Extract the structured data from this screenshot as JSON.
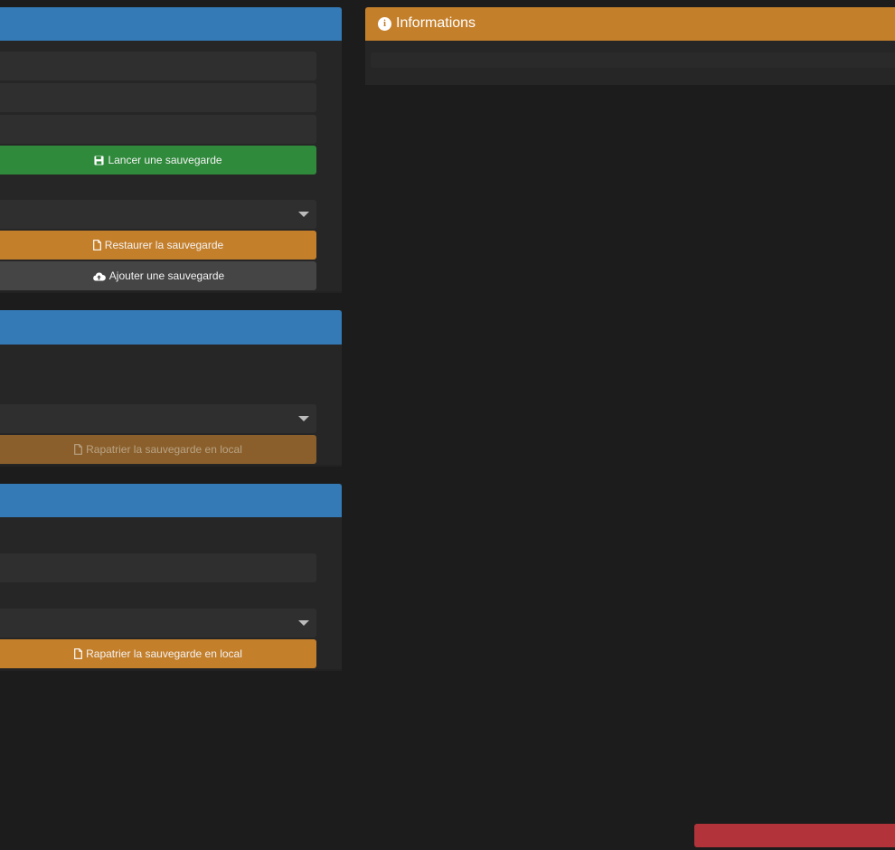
{
  "backup_panel": {
    "launch_button": "Lancer une sauvegarde",
    "restore_button": "Restaurer la sauvegarde",
    "add_button": "Ajouter une sauvegarde"
  },
  "remote_panel_1": {
    "fetch_button": "Rapatrier la sauvegarde en local"
  },
  "remote_panel_2": {
    "fetch_button": "Rapatrier la sauvegarde en local"
  },
  "info_panel": {
    "title": "Informations"
  },
  "colors": {
    "panel_header": "#337ab7",
    "info_header": "#c47f2b",
    "success": "#2f8a3b",
    "warning": "#c47f2b",
    "danger": "#b2343a"
  }
}
